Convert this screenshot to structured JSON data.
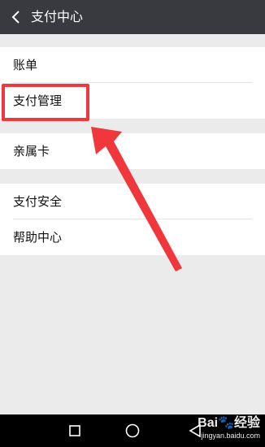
{
  "header": {
    "title": "支付中心",
    "back_icon": "chevron-left-icon"
  },
  "groups": [
    {
      "items": [
        {
          "label": "账单"
        },
        {
          "label": "支付管理"
        }
      ]
    },
    {
      "items": [
        {
          "label": "亲属卡"
        }
      ]
    },
    {
      "items": [
        {
          "label": "支付安全"
        },
        {
          "label": "帮助中心"
        }
      ]
    }
  ],
  "annotation": {
    "color": "#f0383c",
    "target": "支付管理"
  },
  "navbar": {
    "icons": [
      "recent-apps-icon",
      "home-icon",
      "back-icon"
    ]
  },
  "watermark": {
    "brand": "Bai🐾经验",
    "url": "jingyan.baidu.com"
  }
}
